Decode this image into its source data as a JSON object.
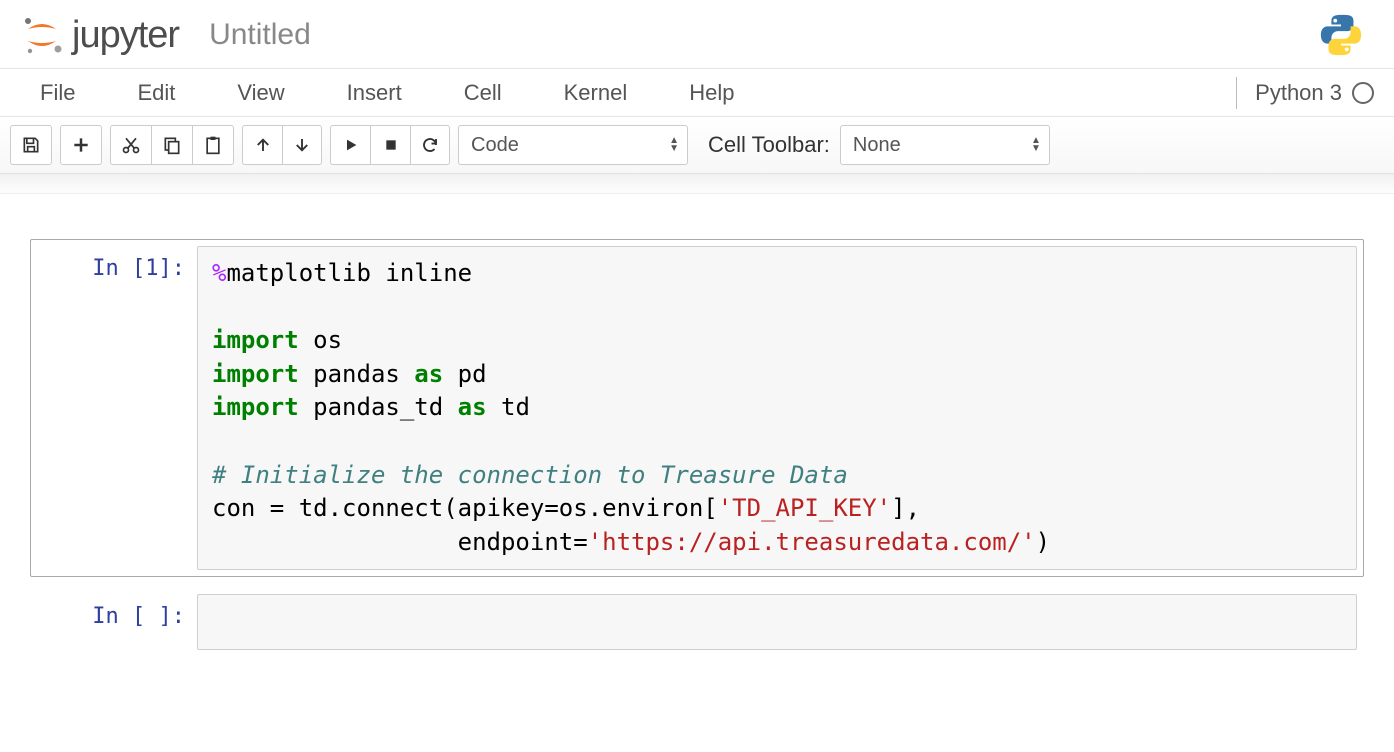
{
  "header": {
    "logo_text": "jupyter",
    "notebook_title": "Untitled"
  },
  "menu": {
    "items": [
      "File",
      "Edit",
      "View",
      "Insert",
      "Cell",
      "Kernel",
      "Help"
    ],
    "kernel_name": "Python 3"
  },
  "toolbar": {
    "cell_type_selected": "Code",
    "cell_toolbar_label": "Cell Toolbar:",
    "cell_toolbar_selected": "None"
  },
  "cells": [
    {
      "prompt": "In [1]:",
      "tokens": [
        {
          "t": "%",
          "c": "tok-magic"
        },
        {
          "t": "matplotlib inline\n\n"
        },
        {
          "t": "import",
          "c": "tok-keyword"
        },
        {
          "t": " os\n"
        },
        {
          "t": "import",
          "c": "tok-keyword"
        },
        {
          "t": " pandas "
        },
        {
          "t": "as",
          "c": "tok-keyword"
        },
        {
          "t": " pd\n"
        },
        {
          "t": "import",
          "c": "tok-keyword"
        },
        {
          "t": " pandas_td "
        },
        {
          "t": "as",
          "c": "tok-keyword"
        },
        {
          "t": " td\n\n"
        },
        {
          "t": "# Initialize the connection to Treasure Data",
          "c": "tok-comment"
        },
        {
          "t": "\n"
        },
        {
          "t": "con = td.connect(apikey=os.environ["
        },
        {
          "t": "'TD_API_KEY'",
          "c": "tok-string"
        },
        {
          "t": "],\n"
        },
        {
          "t": "                 endpoint="
        },
        {
          "t": "'https://api.treasuredata.com/'",
          "c": "tok-string"
        },
        {
          "t": ")"
        }
      ]
    },
    {
      "prompt": "In [ ]:",
      "tokens": []
    }
  ]
}
